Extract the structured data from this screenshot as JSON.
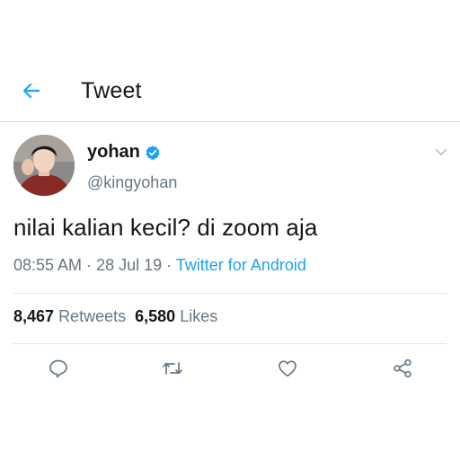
{
  "header": {
    "back_icon": "arrow-left-icon",
    "title": "Tweet"
  },
  "tweet": {
    "author": {
      "display_name": "yohan",
      "verified": true,
      "handle": "@kingyohan"
    },
    "text": "nilai kalian kecil? di zoom aja",
    "time": "08:55 AM",
    "date": "28 Jul 19",
    "source": "Twitter for Android",
    "separator": " · ",
    "stats": {
      "retweets_count": "8,467",
      "retweets_label": "Retweets",
      "likes_count": "6,580",
      "likes_label": "Likes"
    }
  },
  "actions": [
    {
      "icon": "reply-icon"
    },
    {
      "icon": "retweet-icon"
    },
    {
      "icon": "like-icon"
    },
    {
      "icon": "share-icon"
    }
  ],
  "colors": {
    "accent": "#1da1f2",
    "secondary_text": "#657786",
    "primary_text": "#14171a",
    "divider": "#e1e8ed"
  }
}
